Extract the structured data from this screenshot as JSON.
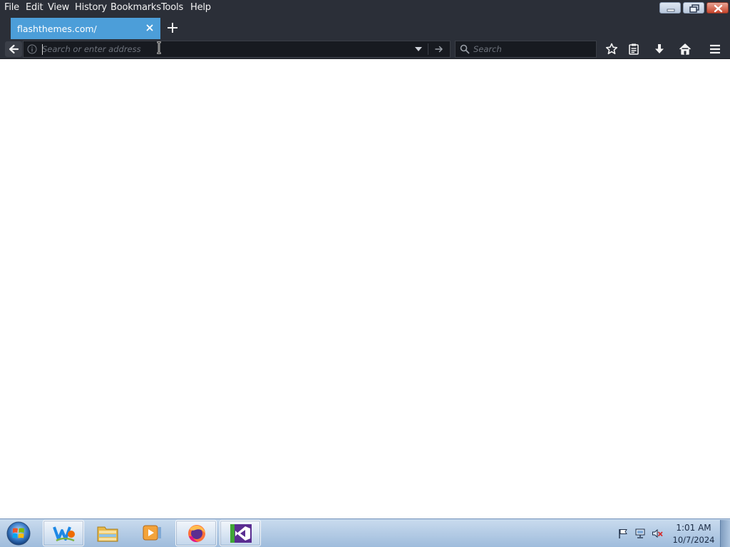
{
  "menubar": {
    "items": [
      "File",
      "Edit",
      "View",
      "History",
      "Bookmarks",
      "Tools",
      "Help"
    ]
  },
  "tab": {
    "title": "flashthemes.com/"
  },
  "navbar": {
    "url_placeholder": "Search or enter address",
    "url_value": "",
    "search_placeholder": "Search"
  },
  "taskbar": {
    "apps": [
      "windows-live-icon",
      "file-explorer-icon",
      "media-player-icon",
      "firefox-icon",
      "visual-studio-icon"
    ],
    "tray": [
      "action-center-flag-icon",
      "network-icon",
      "volume-muted-icon"
    ],
    "clock_time": "1:01 AM",
    "clock_date": "10/7/2024"
  },
  "colors": {
    "chrome_bg": "#2b2f38",
    "tab_active": "#4c9ed9",
    "field_bg": "#171a20",
    "taskbar": "#b4cde8"
  }
}
